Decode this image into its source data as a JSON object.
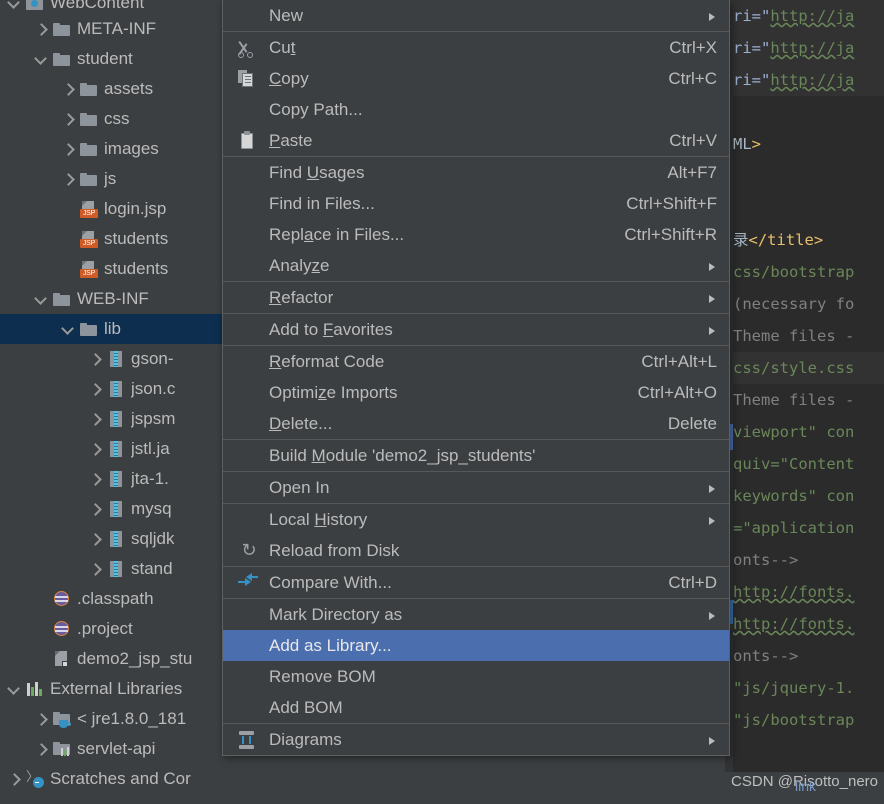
{
  "project_tree": {
    "name": "Project tool window",
    "items": [
      {
        "label": "WebContent",
        "icon": "folder-blue-icon",
        "arrow": "down",
        "indent": 0,
        "selected": false,
        "clipped_top": true
      },
      {
        "label": "META-INF",
        "icon": "folder-icon",
        "arrow": "right",
        "indent": 1,
        "selected": false
      },
      {
        "label": "student",
        "icon": "folder-icon",
        "arrow": "down",
        "indent": 1,
        "selected": false
      },
      {
        "label": "assets",
        "icon": "folder-icon",
        "arrow": "right",
        "indent": 2,
        "selected": false
      },
      {
        "label": "css",
        "icon": "folder-icon",
        "arrow": "right",
        "indent": 2,
        "selected": false
      },
      {
        "label": "images",
        "icon": "folder-icon",
        "arrow": "right",
        "indent": 2,
        "selected": false
      },
      {
        "label": "js",
        "icon": "folder-icon",
        "arrow": "right",
        "indent": 2,
        "selected": false
      },
      {
        "label": "login.jsp",
        "icon": "jsp-file-icon",
        "arrow": "none",
        "indent": 2,
        "selected": false
      },
      {
        "label": "students",
        "icon": "jsp-file-icon",
        "arrow": "none",
        "indent": 2,
        "selected": false
      },
      {
        "label": "students",
        "icon": "jsp-file-icon",
        "arrow": "none",
        "indent": 2,
        "selected": false
      },
      {
        "label": "WEB-INF",
        "icon": "folder-icon",
        "arrow": "down",
        "indent": 1,
        "selected": false
      },
      {
        "label": "lib",
        "icon": "folder-icon",
        "arrow": "down",
        "indent": 2,
        "selected": true
      },
      {
        "label": "gson-",
        "icon": "jar-icon",
        "arrow": "right",
        "indent": 3,
        "selected": false
      },
      {
        "label": "json.c",
        "icon": "jar-icon",
        "arrow": "right",
        "indent": 3,
        "selected": false
      },
      {
        "label": "jspsm",
        "icon": "jar-icon",
        "arrow": "right",
        "indent": 3,
        "selected": false
      },
      {
        "label": "jstl.ja",
        "icon": "jar-icon",
        "arrow": "right",
        "indent": 3,
        "selected": false
      },
      {
        "label": "jta-1.",
        "icon": "jar-icon",
        "arrow": "right",
        "indent": 3,
        "selected": false
      },
      {
        "label": "mysq",
        "icon": "jar-icon",
        "arrow": "right",
        "indent": 3,
        "selected": false
      },
      {
        "label": "sqljdk",
        "icon": "jar-icon",
        "arrow": "right",
        "indent": 3,
        "selected": false
      },
      {
        "label": "stand",
        "icon": "jar-icon",
        "arrow": "right",
        "indent": 3,
        "selected": false
      },
      {
        "label": ".classpath",
        "icon": "classpath-icon",
        "arrow": "none",
        "indent": 1,
        "selected": false
      },
      {
        "label": ".project",
        "icon": "classpath-icon",
        "arrow": "none",
        "indent": 1,
        "selected": false
      },
      {
        "label": "demo2_jsp_stu",
        "icon": "iml-module-icon",
        "arrow": "none",
        "indent": 1,
        "selected": false
      },
      {
        "label": "External Libraries",
        "icon": "external-libraries-icon",
        "arrow": "down",
        "indent": 0,
        "selected": false
      },
      {
        "label": "< jre1.8.0_181",
        "icon": "jre-icon",
        "arrow": "right",
        "indent": 1,
        "selected": false
      },
      {
        "label": "servlet-api",
        "icon": "library-icon",
        "arrow": "right",
        "indent": 1,
        "selected": false
      },
      {
        "label": "Scratches and Cor",
        "icon": "scratches-icon",
        "arrow": "right",
        "indent": 0,
        "selected": false
      }
    ]
  },
  "context_menu": {
    "name": "Project tree right-click context menu",
    "items": [
      {
        "label": "New",
        "mnemonic": "",
        "shortcut": "",
        "icon": "",
        "submenu": true,
        "selected": false
      },
      {
        "separator": true
      },
      {
        "label": "Cut",
        "mnemonic": "t",
        "shortcut": "Ctrl+X",
        "icon": "cut-icon",
        "submenu": false,
        "selected": false
      },
      {
        "label": "Copy",
        "mnemonic": "C",
        "shortcut": "Ctrl+C",
        "icon": "copy-icon",
        "submenu": false,
        "selected": false
      },
      {
        "label": "Copy Path...",
        "mnemonic": "",
        "shortcut": "",
        "icon": "",
        "submenu": false,
        "selected": false
      },
      {
        "label": "Paste",
        "mnemonic": "P",
        "shortcut": "Ctrl+V",
        "icon": "paste-icon",
        "submenu": false,
        "selected": false
      },
      {
        "separator": true
      },
      {
        "label": "Find Usages",
        "mnemonic": "U",
        "shortcut": "Alt+F7",
        "icon": "",
        "submenu": false,
        "selected": false
      },
      {
        "label": "Find in Files...",
        "mnemonic": "",
        "shortcut": "Ctrl+Shift+F",
        "icon": "",
        "submenu": false,
        "selected": false
      },
      {
        "label": "Replace in Files...",
        "mnemonic": "a",
        "shortcut": "Ctrl+Shift+R",
        "icon": "",
        "submenu": false,
        "selected": false
      },
      {
        "label": "Analyze",
        "mnemonic": "z",
        "shortcut": "",
        "icon": "",
        "submenu": true,
        "selected": false
      },
      {
        "separator": true
      },
      {
        "label": "Refactor",
        "mnemonic": "R",
        "shortcut": "",
        "icon": "",
        "submenu": true,
        "selected": false
      },
      {
        "separator": true
      },
      {
        "label": "Add to Favorites",
        "mnemonic": "F",
        "shortcut": "",
        "icon": "",
        "submenu": true,
        "selected": false
      },
      {
        "separator": true
      },
      {
        "label": "Reformat Code",
        "mnemonic": "R",
        "shortcut": "Ctrl+Alt+L",
        "icon": "",
        "submenu": false,
        "selected": false
      },
      {
        "label": "Optimize Imports",
        "mnemonic": "z",
        "shortcut": "Ctrl+Alt+O",
        "icon": "",
        "submenu": false,
        "selected": false
      },
      {
        "label": "Delete...",
        "mnemonic": "D",
        "shortcut": "Delete",
        "icon": "",
        "submenu": false,
        "selected": false
      },
      {
        "separator": true
      },
      {
        "label": "Build Module 'demo2_jsp_students'",
        "mnemonic": "M",
        "shortcut": "",
        "icon": "",
        "submenu": false,
        "selected": false
      },
      {
        "separator": true
      },
      {
        "label": "Open In",
        "mnemonic": "",
        "shortcut": "",
        "icon": "",
        "submenu": true,
        "selected": false
      },
      {
        "separator": true
      },
      {
        "label": "Local History",
        "mnemonic": "H",
        "shortcut": "",
        "icon": "",
        "submenu": true,
        "selected": false
      },
      {
        "label": "Reload from Disk",
        "mnemonic": "",
        "shortcut": "",
        "icon": "reload-icon",
        "submenu": false,
        "selected": false
      },
      {
        "separator": true
      },
      {
        "label": "Compare With...",
        "mnemonic": "",
        "shortcut": "Ctrl+D",
        "icon": "compare-icon",
        "submenu": false,
        "selected": false
      },
      {
        "separator": true
      },
      {
        "label": "Mark Directory as",
        "mnemonic": "",
        "shortcut": "",
        "icon": "",
        "submenu": true,
        "selected": false
      },
      {
        "label": "Add as Library...",
        "mnemonic": "",
        "shortcut": "",
        "icon": "",
        "submenu": false,
        "selected": true
      },
      {
        "label": "Remove BOM",
        "mnemonic": "",
        "shortcut": "",
        "icon": "",
        "submenu": false,
        "selected": false
      },
      {
        "label": "Add BOM",
        "mnemonic": "",
        "shortcut": "",
        "icon": "",
        "submenu": false,
        "selected": false
      },
      {
        "separator": true
      },
      {
        "label": "Diagrams",
        "mnemonic": "",
        "shortcut": "",
        "icon": "diagrams-icon",
        "submenu": true,
        "selected": false
      }
    ]
  },
  "editor": {
    "name": "Code editor (partially occluded by menu)",
    "lines": [
      {
        "highlight": true,
        "spans": [
          {
            "t": "ri=\"",
            "c": "t-attr"
          },
          {
            "t": "http://ja",
            "c": "t-str sq"
          }
        ]
      },
      {
        "highlight": true,
        "spans": [
          {
            "t": "ri=\"",
            "c": "t-attr"
          },
          {
            "t": "http://ja",
            "c": "t-str sq"
          }
        ]
      },
      {
        "highlight": true,
        "spans": [
          {
            "t": "ri=\"",
            "c": "t-attr"
          },
          {
            "t": "http://ja",
            "c": "t-str sq"
          }
        ]
      },
      {
        "highlight": false,
        "spans": []
      },
      {
        "highlight": false,
        "spans": [
          {
            "t": "ML",
            "c": "t-plain"
          },
          {
            "t": ">",
            "c": "t-tag"
          }
        ]
      },
      {
        "highlight": false,
        "spans": []
      },
      {
        "highlight": false,
        "spans": []
      },
      {
        "highlight": false,
        "spans": [
          {
            "t": "录",
            "c": "t-cjk"
          },
          {
            "t": "</title>",
            "c": "t-tag"
          }
        ]
      },
      {
        "highlight": false,
        "spans": [
          {
            "t": "css/bootstrap",
            "c": "t-str"
          }
        ]
      },
      {
        "highlight": false,
        "spans": [
          {
            "t": "(necessary fo",
            "c": "t-cmt"
          }
        ]
      },
      {
        "highlight": false,
        "spans": [
          {
            "t": "Theme files -",
            "c": "t-cmt"
          }
        ]
      },
      {
        "highlight": true,
        "spans": [
          {
            "t": "css/style.css",
            "c": "t-str"
          }
        ]
      },
      {
        "highlight": false,
        "spans": [
          {
            "t": "Theme files -",
            "c": "t-cmt"
          }
        ]
      },
      {
        "highlight": false,
        "spans": [
          {
            "t": "viewport\" con",
            "c": "t-str"
          }
        ]
      },
      {
        "highlight": false,
        "spans": [
          {
            "t": "quiv=\"Content",
            "c": "t-str"
          }
        ]
      },
      {
        "highlight": false,
        "spans": [
          {
            "t": "keywords\" con",
            "c": "t-str"
          }
        ]
      },
      {
        "highlight": false,
        "spans": [
          {
            "t": "=\"application",
            "c": "t-str"
          }
        ]
      },
      {
        "highlight": false,
        "spans": [
          {
            "t": "onts-->",
            "c": "t-cmt"
          }
        ]
      },
      {
        "highlight": false,
        "spans": [
          {
            "t": "http://fonts.",
            "c": "t-str sq"
          }
        ]
      },
      {
        "highlight": false,
        "spans": [
          {
            "t": "http://fonts.",
            "c": "t-str sq"
          }
        ]
      },
      {
        "highlight": false,
        "spans": [
          {
            "t": "onts-->",
            "c": "t-cmt"
          }
        ]
      },
      {
        "highlight": false,
        "spans": [
          {
            "t": "\"js/jquery-1.",
            "c": "t-str"
          }
        ]
      },
      {
        "highlight": false,
        "spans": [
          {
            "t": "\"js/bootstrap",
            "c": "t-str"
          }
        ]
      }
    ]
  },
  "watermark": {
    "text": "CSDN @Risotto_nero",
    "link_text": "link"
  },
  "colors": {
    "background": "#3c3f41",
    "editor_background": "#2b2b2b",
    "menu_highlight": "#4b6eaf",
    "tree_selection": "#0d2e4f",
    "text": "#bbbbbb",
    "string": "#6a8759",
    "tag": "#e8bf6a",
    "attribute": "#9db0d4",
    "comment": "#808080",
    "accent_blue": "#3592c4"
  }
}
